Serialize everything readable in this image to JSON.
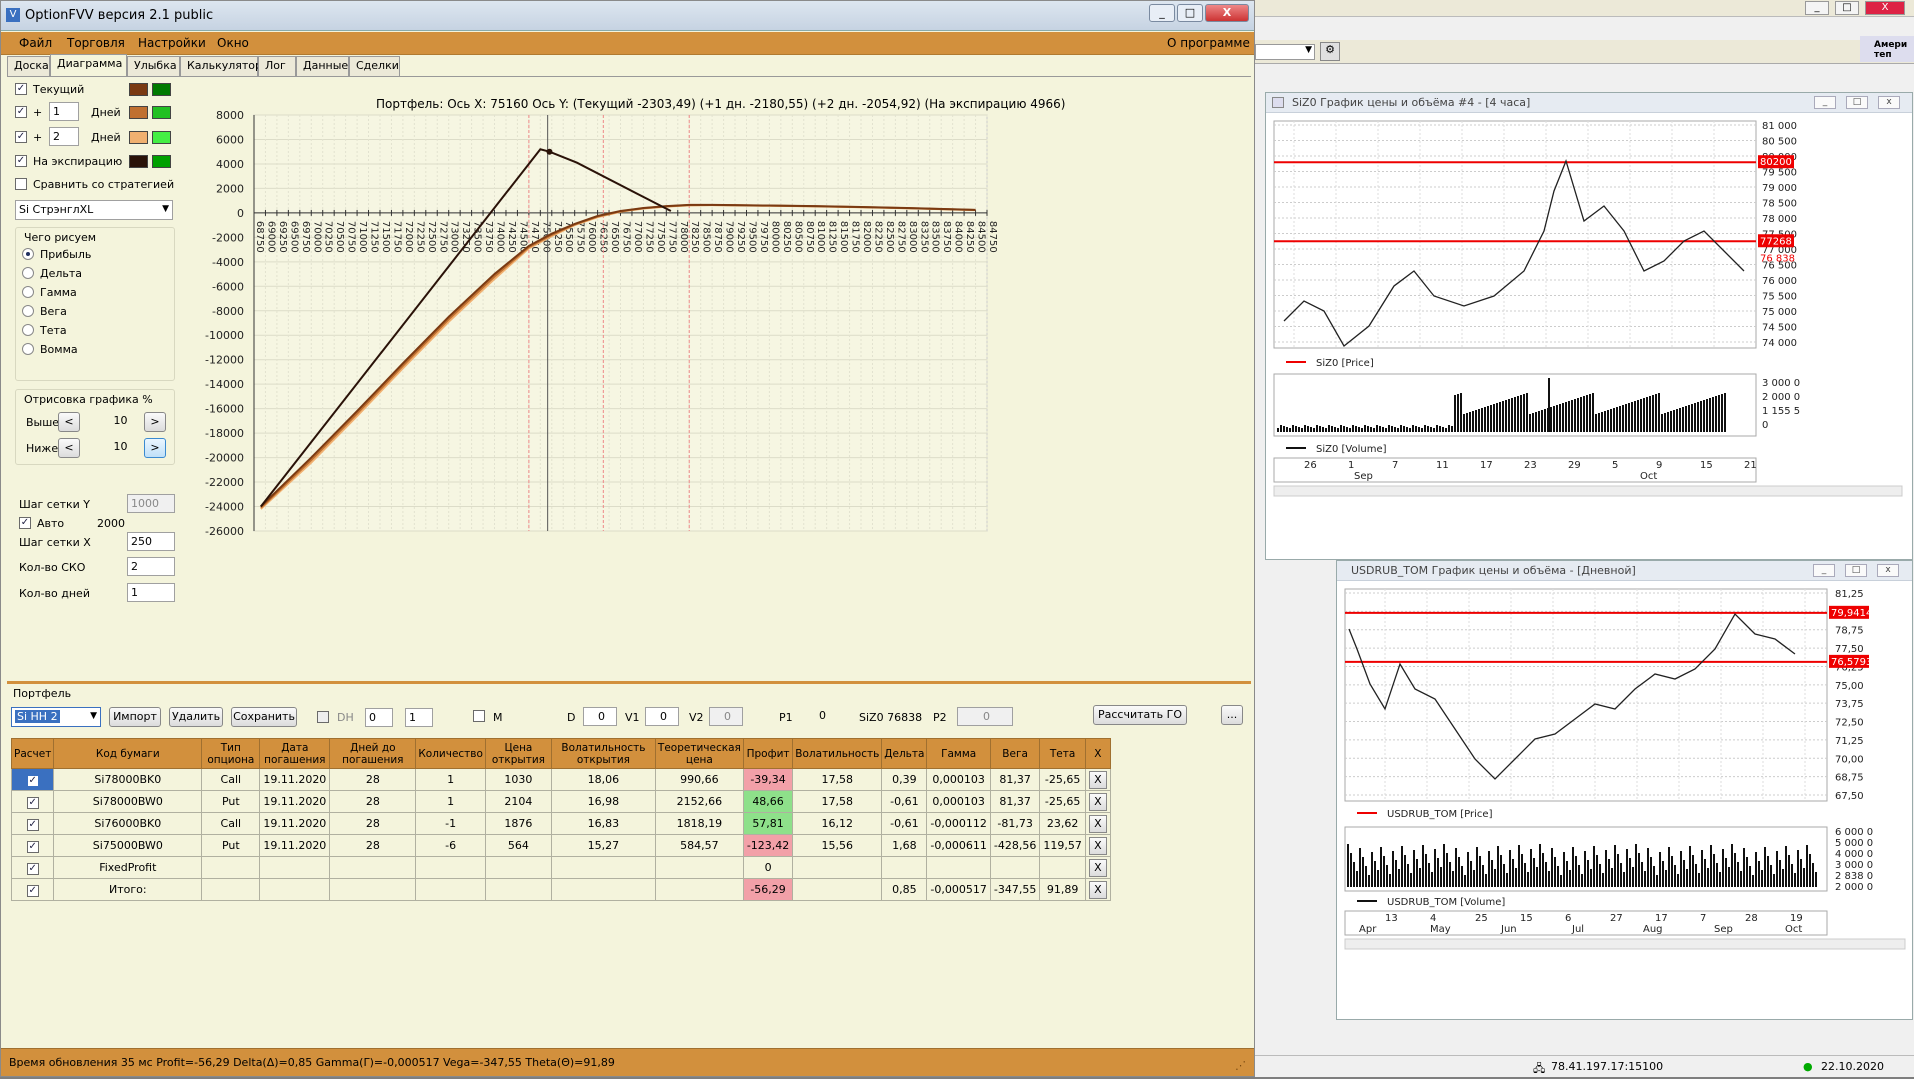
{
  "app": {
    "title": "OptionFVV версия 2.1 public",
    "menu": [
      "Файл",
      "Торговля",
      "Настройки",
      "Окно"
    ],
    "about": "О программе",
    "window_buttons": [
      "_",
      "□",
      "X"
    ]
  },
  "tabs": [
    "Доска",
    "Диаграмма",
    "Улыбка",
    "Калькулятор",
    "Лог",
    "Данные",
    "Сделки"
  ],
  "left_panel": {
    "lines": [
      {
        "checked": true,
        "prefix": "",
        "value": "",
        "label": "Текущий",
        "colors": [
          "#7a3a12",
          "#007a00"
        ]
      },
      {
        "checked": true,
        "prefix": "+",
        "value": "1",
        "label": "Дней",
        "colors": [
          "#c07030",
          "#22c022"
        ]
      },
      {
        "checked": true,
        "prefix": "+",
        "value": "2",
        "label": "Дней",
        "colors": [
          "#f0b070",
          "#44ee44"
        ]
      },
      {
        "checked": true,
        "prefix": "",
        "value": "",
        "label": "На экспирацию",
        "colors": [
          "#2a1208",
          "#00a000"
        ]
      }
    ],
    "compare_label": "Сравнить со стратегией",
    "compare_checked": false,
    "strategy": "Si СтрэнглXL",
    "what_group": "Чего рисуем",
    "what_options": [
      "Прибыль",
      "Дельта",
      "Гамма",
      "Вега",
      "Тета",
      "Вомма"
    ],
    "what_selected": 0,
    "render_group": "Отрисовка графика %",
    "above_label": "Выше",
    "above_value": "10",
    "below_label": "Ниже",
    "below_value": "10",
    "dec": "<",
    "inc": ">",
    "grid_y_label": "Шаг сетки Y",
    "grid_y_value": "1000",
    "auto_label": "Авто",
    "auto_checked": true,
    "auto_value": "2000",
    "grid_x_label": "Шаг сетки X",
    "grid_x_value": "250",
    "sko_label": "Кол-во СКО",
    "sko_value": "2",
    "days_label": "Кол-во дней",
    "days_value": "1"
  },
  "chart_data": {
    "type": "line",
    "title": "",
    "header": "Портфель: Ось X: 75160 Ось Y:  (Текущий -2303,49)  (+1 дн. -2180,55)  (+2 дн. -2054,92)  (На экспирацию 4966)",
    "xlim": [
      68750,
      84750
    ],
    "ylim": [
      -26000,
      8000
    ],
    "x_tick_step": 250,
    "y_tick_step": 2000,
    "grid": true,
    "crosshair_x": 75160,
    "red_vlines": [
      74750,
      76375,
      78250
    ],
    "series": [
      {
        "name": "На экспирацию",
        "color": "#2a1208",
        "x": [
          68900,
          75000,
          75200,
          75800,
          77850
        ],
        "y": [
          -24000,
          5200,
          5000,
          4100,
          150
        ]
      },
      {
        "name": "Текущий",
        "color": "#7a3a12",
        "x": [
          68900,
          70000,
          71000,
          72000,
          73000,
          74000,
          74750,
          75250,
          75750,
          76250,
          76750,
          77250,
          77750,
          78250,
          78750,
          79250,
          80000,
          81000,
          82000,
          83000,
          84000,
          84500
        ],
        "y": [
          -24000,
          -20000,
          -16200,
          -12300,
          -8500,
          -5000,
          -2700,
          -1700,
          -900,
          -250,
          150,
          400,
          550,
          650,
          650,
          630,
          600,
          550,
          480,
          400,
          300,
          250
        ]
      },
      {
        "name": "+1 дн.",
        "color": "#c07030",
        "x": [
          68900,
          70000,
          71000,
          72000,
          73000,
          74000,
          74750,
          75250,
          75750,
          76250,
          76750,
          77250,
          77750,
          78250,
          78750,
          79250,
          80000,
          81000,
          82000,
          83000,
          84000,
          84500
        ],
        "y": [
          -24100,
          -20200,
          -16400,
          -12500,
          -8700,
          -5200,
          -2800,
          -1800,
          -950,
          -300,
          120,
          380,
          530,
          630,
          640,
          620,
          590,
          540,
          470,
          390,
          290,
          240
        ]
      },
      {
        "name": "+2 дн.",
        "color": "#f0b070",
        "x": [
          68900,
          70000,
          71000,
          72000,
          73000,
          74000,
          74750,
          75250,
          75750,
          76250,
          76750,
          77250,
          77750,
          78250,
          78750,
          79250,
          80000,
          81000,
          82000,
          83000,
          84000,
          84500
        ],
        "y": [
          -24200,
          -20400,
          -16600,
          -12700,
          -8900,
          -5400,
          -2900,
          -1900,
          -1000,
          -350,
          90,
          360,
          510,
          610,
          630,
          610,
          580,
          530,
          460,
          380,
          280,
          230
        ]
      }
    ]
  },
  "portfolio": {
    "label": "Портфель",
    "name": "Si НН 2",
    "import": "Импорт",
    "delete": "Удалить",
    "save": "Сохранить",
    "dh_label": "DH",
    "m_label": "M",
    "spin1": "0",
    "spin2": "1",
    "d_label": "D",
    "d_value": "0",
    "v1_label": "V1",
    "v1_value": "0",
    "v2_label": "V2",
    "v2_value": "0",
    "p1_label": "P1",
    "p1_value": "0",
    "siz_label": "SiZ0 76838",
    "p2_label": "P2",
    "p2_value": "0",
    "calc_go": "Рассчитать ГО",
    "more": "..."
  },
  "table": {
    "headers": [
      "Расчет",
      "Код бумаги",
      "Тип опциона",
      "Дата погашения",
      "Дней до погашения",
      "Количество",
      "Цена открытия",
      "Волатильность открытия",
      "Теоретическая цена",
      "Профит",
      "Волатильность",
      "Дельта",
      "Гамма",
      "Вега",
      "Тета",
      "X"
    ],
    "rows": [
      [
        "Si78000BK0",
        "Call",
        "19.11.2020",
        "28",
        "1",
        "1030",
        "18,06",
        "990,66",
        "-39,34",
        "17,58",
        "0,39",
        "0,000103",
        "81,37",
        "-25,65"
      ],
      [
        "Si78000BW0",
        "Put",
        "19.11.2020",
        "28",
        "1",
        "2104",
        "16,98",
        "2152,66",
        "48,66",
        "17,58",
        "-0,61",
        "0,000103",
        "81,37",
        "-25,65"
      ],
      [
        "Si76000BK0",
        "Call",
        "19.11.2020",
        "28",
        "-1",
        "1876",
        "16,83",
        "1818,19",
        "57,81",
        "16,12",
        "-0,61",
        "-0,000112",
        "-81,73",
        "23,62"
      ],
      [
        "Si75000BW0",
        "Put",
        "19.11.2020",
        "28",
        "-6",
        "564",
        "15,27",
        "584,57",
        "-123,42",
        "15,56",
        "1,68",
        "-0,000611",
        "-428,56",
        "119,57"
      ],
      [
        "FixedProfit",
        "",
        "",
        "",
        "",
        "",
        "",
        "",
        "0",
        "",
        "",
        "",
        "",
        ""
      ],
      [
        "Итого:",
        "",
        "",
        "",
        "",
        "",
        "",
        "",
        "-56,29",
        "",
        "0,85",
        "-0,000517",
        "-347,55",
        "91,89"
      ]
    ],
    "profit_colors": [
      "red",
      "green",
      "green",
      "red",
      "",
      "red"
    ],
    "x_label": "X"
  },
  "status": "Время обновления 35 мс  Profit=-56,29 Delta(Δ)=0,85 Gamma(Γ)=-0,000517 Vega=-347,55 Theta(Θ)=91,89",
  "bg": {
    "chart1_title": "SiZ0 График цены и объёма #4 - [4 часа]",
    "chart1_prices": [
      "81 000",
      "80 500",
      "80 000",
      "79 500",
      "79 000",
      "78 500",
      "78 000",
      "77 500",
      "77 000",
      "76 500",
      "76 000",
      "75 500",
      "75 000",
      "74 500",
      "74 000"
    ],
    "chart1_tag_hi": "80200",
    "chart1_tag_lo": "77268",
    "chart1_tag_cur": "76 838",
    "chart1_legend": "SiZ0 [Price]",
    "chart1_vol_legend": "SiZ0 [Volume]",
    "chart1_vol_labels": [
      "3 000 0",
      "2 000 0",
      "1 155 5",
      "0"
    ],
    "chart1_days": [
      "26",
      "1",
      "7",
      "11",
      "17",
      "23",
      "29",
      "5",
      "9",
      "15",
      "21"
    ],
    "chart1_months": [
      "Sep",
      "Oct"
    ],
    "chart2_title": "USDRUB_TOM График цены и объёма - [Дневной]",
    "chart2_prices": [
      "81,25",
      "80,00",
      "78,75",
      "77,50",
      "76,25",
      "75,00",
      "73,75",
      "72,50",
      "71,25",
      "70,00",
      "68,75",
      "67,50"
    ],
    "chart2_tag_hi": "79,9414",
    "chart2_tag_lo": "76,5793",
    "chart2_legend": "USDRUB_TOM [Price]",
    "chart2_vol_legend": "USDRUB_TOM [Volume]",
    "chart2_vol_labels": [
      "6 000 0",
      "5 000 0",
      "4 000 0",
      "3 000 0",
      "2 838 0",
      "2 000 0"
    ],
    "chart2_days": [
      "13",
      "4",
      "25",
      "15",
      "6",
      "27",
      "17",
      "7",
      "28",
      "19"
    ],
    "chart2_months": [
      "Apr",
      "May",
      "Jun",
      "Jul",
      "Aug",
      "Sep",
      "Oct"
    ],
    "top_right": "Амери теп",
    "status_ip": "78.41.197.17:15100",
    "status_date": "22.10.2020"
  }
}
